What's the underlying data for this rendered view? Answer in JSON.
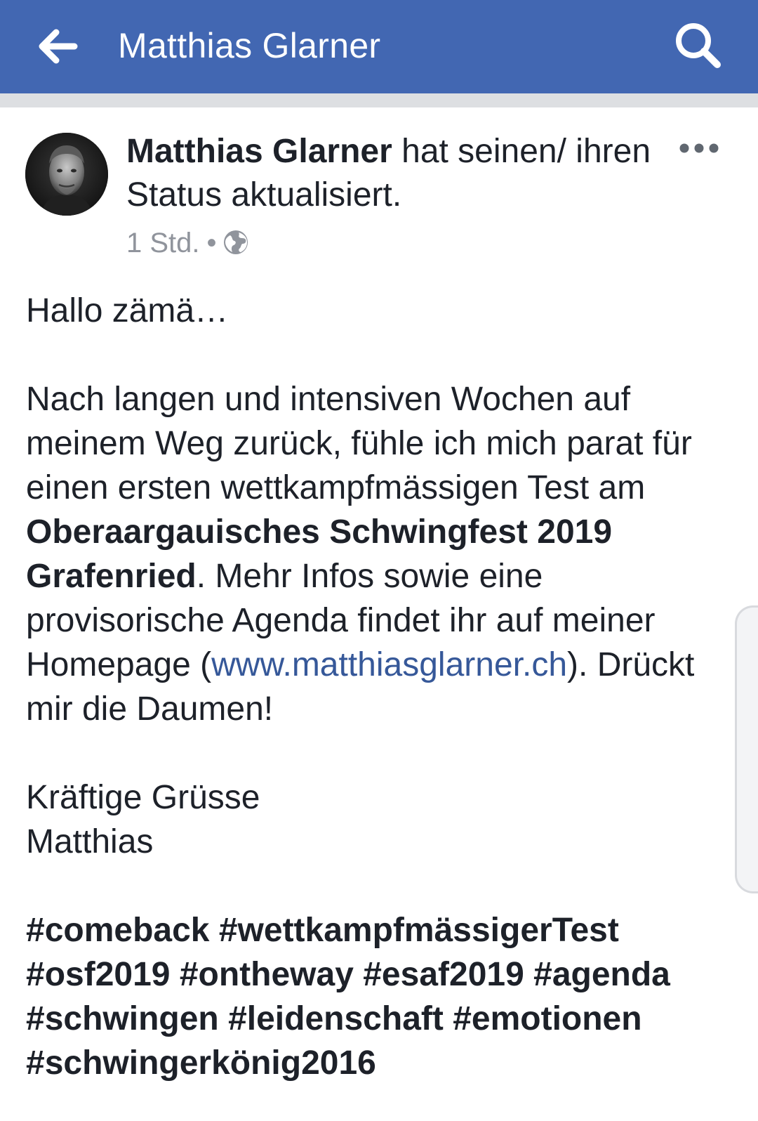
{
  "header": {
    "title": "Matthias Glarner",
    "back_icon": "arrow-left-icon",
    "search_icon": "search-icon",
    "background_color": "#4267b2"
  },
  "post": {
    "author": "Matthias Glarner",
    "action_text": " hat seinen/ ihren Status aktualisiert.",
    "time": "1 Std.",
    "separator": "•",
    "privacy_icon": "globe-icon",
    "more_icon": "more-dots-icon",
    "body": {
      "greeting": "Hallo zämä…",
      "paragraph_part1": "Nach langen und intensiven Wochen auf meinem Weg zurück, fühle ich mich parat für einen ersten wettkampfmässigen Test am ",
      "event_bold": "Oberaargauisches Schwingfest 2019 Grafenried",
      "paragraph_part2": ". Mehr Infos sowie eine provisorische Agenda findet ihr auf meiner Homepage (",
      "link_text": "www.matthiasglarner.ch",
      "paragraph_part3": "). Drückt mir die Daumen!",
      "closing": "Kräftige Grüsse",
      "signature": "Matthias",
      "hashtags": [
        "#comeback",
        "#wettkampfmässigerTest",
        "#osf2019",
        "#ontheway",
        "#esaf2019",
        "#agenda",
        "#schwingen",
        "#leidenschaft",
        "#emotionen",
        "#schwingerkönig2016"
      ]
    },
    "link_color": "#365899"
  }
}
